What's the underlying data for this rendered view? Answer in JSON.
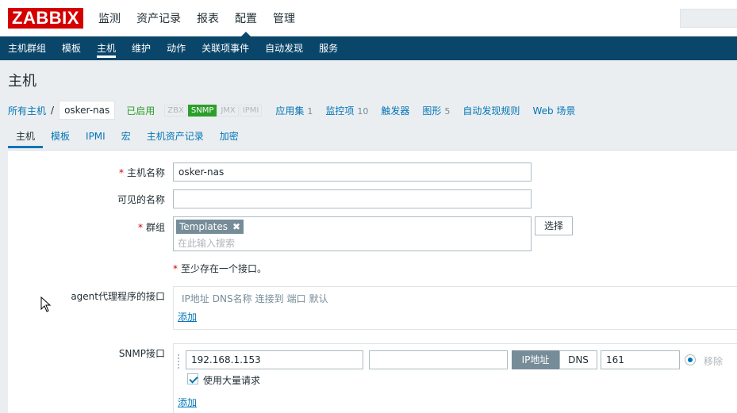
{
  "app": {
    "logo": "ZABBIX"
  },
  "top_menu": [
    {
      "label": "监测"
    },
    {
      "label": "资产记录"
    },
    {
      "label": "报表"
    },
    {
      "label": "配置",
      "active": true
    },
    {
      "label": "管理"
    }
  ],
  "sub_menu": [
    {
      "label": "主机群组"
    },
    {
      "label": "模板"
    },
    {
      "label": "主机",
      "active": true
    },
    {
      "label": "维护"
    },
    {
      "label": "动作"
    },
    {
      "label": "关联项事件"
    },
    {
      "label": "自动发现"
    },
    {
      "label": "服务"
    }
  ],
  "page": {
    "title": "主机"
  },
  "host_nav": {
    "all_hosts": "所有主机",
    "separator": "/",
    "current": "osker-nas",
    "status": "已启用",
    "availability": [
      "ZBX",
      "SNMP",
      "JMX",
      "IPMI"
    ],
    "availability_active": "SNMP",
    "applications": {
      "label": "应用集",
      "count": "1"
    },
    "items": {
      "label": "监控项",
      "count": "10"
    },
    "triggers": {
      "label": "触发器"
    },
    "graphs": {
      "label": "图形",
      "count": "5"
    },
    "discovery": {
      "label": "自动发现规则"
    },
    "web": {
      "label": "Web 场景"
    }
  },
  "tabs": [
    {
      "label": "主机",
      "active": true
    },
    {
      "label": "模板"
    },
    {
      "label": "IPMI"
    },
    {
      "label": "宏"
    },
    {
      "label": "主机资产记录"
    },
    {
      "label": "加密"
    }
  ],
  "form": {
    "hostname_label": "主机名称",
    "hostname_value": "osker-nas",
    "visible_name_label": "可见的名称",
    "visible_name_value": "",
    "groups_label": "群组",
    "group_tag": "Templates",
    "group_remove": "✖",
    "groups_placeholder": "在此输入搜索",
    "select_button": "选择",
    "required_asterisk": "*",
    "interface_note": "至少存在一个接口。",
    "agent_label": "agent代理程序的接口",
    "agent_headers": [
      "IP地址",
      "DNS名称",
      "连接到",
      "端口",
      "默认"
    ],
    "agent_add": "添加",
    "snmp_label": "SNMP接口",
    "snmp_ip": "192.168.1.153",
    "snmp_dns": "",
    "connect_ip": "IP地址",
    "connect_dns": "DNS",
    "snmp_port": "161",
    "remove": "移除",
    "bulk_label": "使用大量请求",
    "snmp_add": "添加"
  },
  "colors": {
    "logo_bg": "#d40000",
    "submenu_bg": "#0a466a",
    "link": "#0275b8",
    "enabled": "#2d9e2b",
    "toggle_active_bg": "#768d99"
  }
}
